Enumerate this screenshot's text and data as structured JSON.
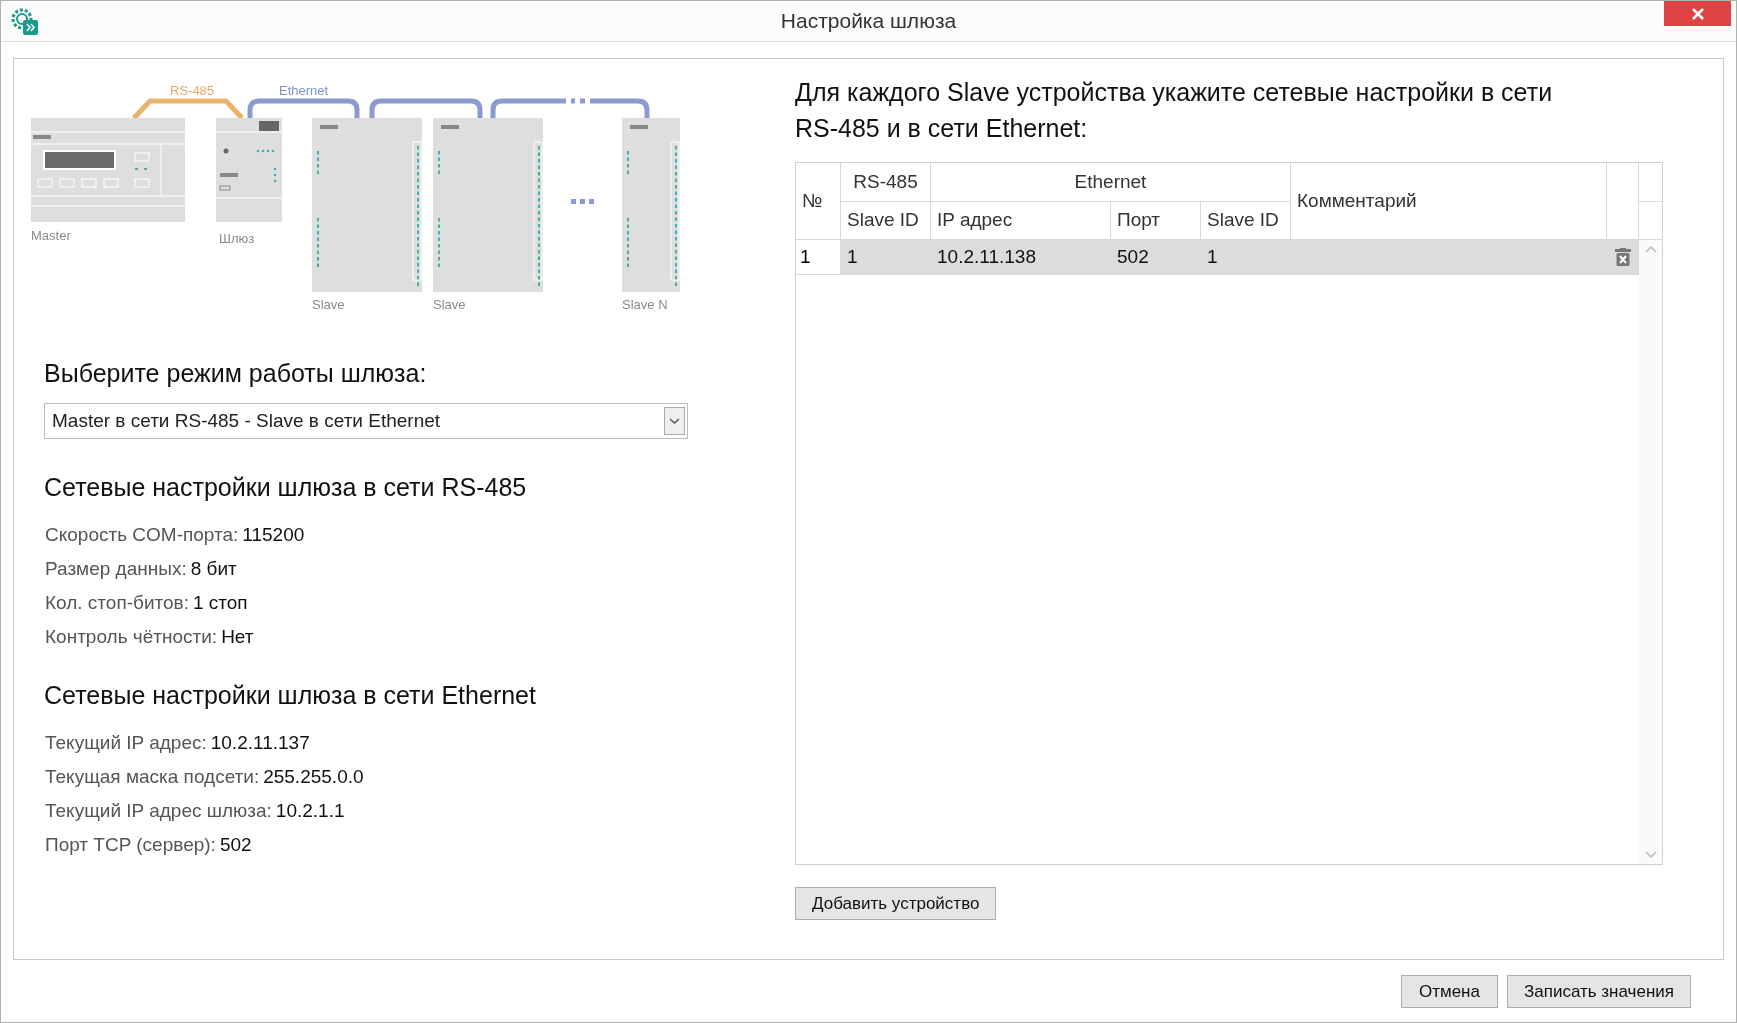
{
  "window": {
    "title": "Настройка шлюза"
  },
  "diagram": {
    "link_labels": [
      "RS-485",
      "Ethernet"
    ],
    "device_labels": [
      "Master",
      "Шлюз",
      "Slave",
      "Slave",
      "Slave N"
    ]
  },
  "mode": {
    "heading": "Выберите режим работы шлюза:",
    "value": "Master в сети RS-485 - Slave в сети Ethernet"
  },
  "rs485": {
    "heading": "Сетевые настройки шлюза в сети RS-485",
    "fields": [
      {
        "label": "Скорость COM-порта:",
        "value": "115200"
      },
      {
        "label": "Размер данных:",
        "value": "8 бит"
      },
      {
        "label": "Кол. стоп-битов:",
        "value": "1 стоп"
      },
      {
        "label": "Контроль чётности:",
        "value": "Нет"
      }
    ]
  },
  "ethernet": {
    "heading": "Сетевые настройки шлюза в сети Ethernet",
    "fields": [
      {
        "label": "Текущий IP адрес:",
        "value": "10.2.11.137"
      },
      {
        "label": "Текущая маска подсети:",
        "value": "255.255.0.0"
      },
      {
        "label": "Текущий IP адрес шлюза:",
        "value": "10.2.1.1"
      },
      {
        "label": "Порт TCP (сервер):",
        "value": "502"
      }
    ]
  },
  "slaves": {
    "heading": "Для каждого Slave устройства укажите сетевые настройки в сети RS-485 и в сети Ethernet:",
    "header": {
      "number": "№",
      "rs485_group": "RS-485",
      "ethernet_group": "Ethernet",
      "comment": "Комментарий",
      "rs485_columns": [
        "Slave ID"
      ],
      "ethernet_columns": [
        "IP адрес",
        "Порт",
        "Slave ID"
      ]
    },
    "rows": [
      {
        "number": "1",
        "rs485_slave_id": "1",
        "ip": "10.2.11.138",
        "port": "502",
        "eth_slave_id": "1",
        "selected": true
      }
    ]
  },
  "add_button": "Добавить устройство",
  "buttons": [
    "Отмена",
    "Записать значения"
  ]
}
